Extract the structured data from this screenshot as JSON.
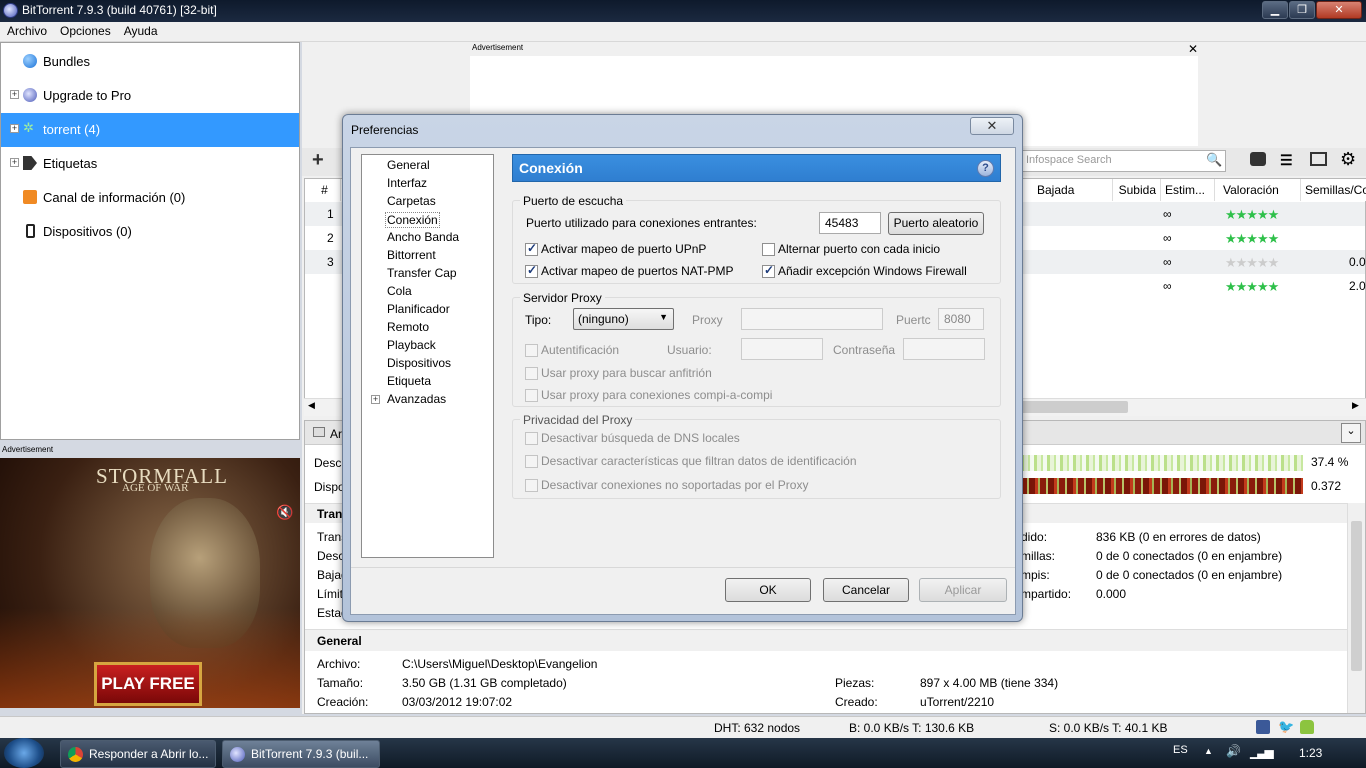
{
  "window": {
    "title": "BitTorrent 7.9.3  (build 40761) [32-bit]",
    "minimize": "▁",
    "restore": "❐",
    "close": "✕"
  },
  "menu": [
    "Archivo",
    "Opciones",
    "Ayuda"
  ],
  "sidebar": {
    "items": [
      {
        "label": "Bundles"
      },
      {
        "label": "Upgrade to Pro"
      },
      {
        "label": "torrent (4)"
      },
      {
        "label": "Etiquetas"
      },
      {
        "label": "Canal de información (0)"
      },
      {
        "label": "Dispositivos (0)"
      }
    ],
    "ad_label": "Advertisement"
  },
  "ad": {
    "title": "STORMFALL",
    "subtitle": "AGE OF WAR",
    "cta": "PLAY FREE"
  },
  "top_ad": {
    "label": "Advertisement",
    "close": "✕"
  },
  "toolbar": {
    "add": "+",
    "search_placeholder": "Infospace Search"
  },
  "torrent_list": {
    "columns": {
      "num": "#",
      "bajada": "Bajada",
      "subida": "Subida",
      "estim": "Estim...",
      "valoracion": "Valoración",
      "semillas": "Semillas/Co"
    },
    "rows": [
      {
        "num": "1",
        "estim": "∞",
        "rating": "★★★★★",
        "seeds": ""
      },
      {
        "num": "2",
        "estim": "∞",
        "rating": "★★★★★",
        "seeds": ""
      },
      {
        "num": "3",
        "estim": "∞",
        "rating": "★★★★★",
        "seeds": "0.0"
      },
      {
        "num": "",
        "estim": "∞",
        "rating": "★★★★★",
        "seeds": "2.0"
      }
    ]
  },
  "details": {
    "tab_partial": "Ar",
    "descarga_partial": "Desca",
    "dispo_partial": "Dispo",
    "pct": "37.4 %",
    "avail": "0.372",
    "transfer_header_partial": "Trans",
    "left_labels": [
      "Trans",
      "Desc",
      "Bajad",
      "Límit",
      "Estad"
    ],
    "right_labels": [
      "dido:",
      "millas:",
      "mpis:",
      "mpartido:"
    ],
    "right_values": [
      "836 KB (0 en errores de datos)",
      "0 de 0 conectados (0 en enjambre)",
      "0 de 0 conectados (0 en enjambre)",
      "0.000"
    ],
    "general_header": "General",
    "archivo_label": "Archivo:",
    "archivo_value": "C:\\Users\\Miguel\\Desktop\\Evangelion",
    "tamano_label": "Tamaño:",
    "tamano_value": "3.50 GB (1.31 GB completado)",
    "creacion_label": "Creación:",
    "creacion_value": "03/03/2012 19:07:02",
    "piezas_label": "Piezas:",
    "piezas_value": "897 x 4.00 MB (tiene 334)",
    "creado_label": "Creado:",
    "creado_value": "uTorrent/2210"
  },
  "statusbar": {
    "dht": "DHT: 632 nodos",
    "down": "B: 0.0 KB/s T: 130.6 KB",
    "up": "S: 0.0 KB/s T: 40.1 KB"
  },
  "taskbar": {
    "buttons": [
      {
        "label": "Responder a Abrir lo..."
      },
      {
        "label": "BitTorrent 7.9.3  (buil..."
      }
    ],
    "lang": "ES",
    "clock": "1:23"
  },
  "dialog": {
    "title": "Preferencias",
    "close": "✕",
    "tree": [
      "General",
      "Interfaz",
      "Carpetas",
      "Conexión",
      "Ancho Banda",
      "Bittorrent",
      "Transfer Cap",
      "Cola",
      "Planificador",
      "Remoto",
      "Playback",
      "Dispositivos",
      "Etiqueta",
      "Avanzadas"
    ],
    "selected": "Conexión",
    "header": "Conexión",
    "help": "?",
    "listen": {
      "group": "Puerto de escucha",
      "port_label": "Puerto utilizado para conexiones entrantes:",
      "port_value": "45483",
      "random_btn": "Puerto aleatorio",
      "upnp": "Activar mapeo de puerto UPnP",
      "natpmp": "Activar mapeo de puertos NAT-PMP",
      "alternate": "Alternar puerto con cada inicio",
      "firewall": "Añadir excepción Windows Firewall"
    },
    "proxy": {
      "group": "Servidor Proxy",
      "type_label": "Tipo:",
      "type_value": "(ninguno)",
      "proxy_label": "Proxy",
      "port_label": "Puertc",
      "port_value": "8080",
      "auth": "Autentificación",
      "user_label": "Usuario:",
      "pass_label": "Contraseña",
      "resolve": "Usar proxy para buscar anfitrión",
      "p2p": "Usar proxy para conexiones compi-a-compi"
    },
    "privacy": {
      "group": "Privacidad del Proxy",
      "dns": "Desactivar búsqueda de DNS locales",
      "features": "Desactivar características que filtran datos de identificación",
      "unsupported": "Desactivar conexiones no soportadas por el Proxy"
    },
    "buttons": {
      "ok": "OK",
      "cancel": "Cancelar",
      "apply": "Aplicar"
    }
  }
}
